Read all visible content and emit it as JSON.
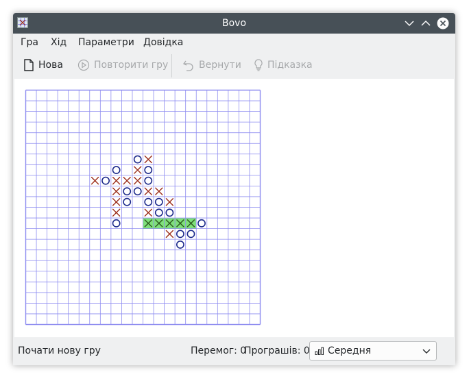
{
  "window": {
    "title": "Bovo"
  },
  "menu": [
    "Гра",
    "Хід",
    "Параметри",
    "Довідка"
  ],
  "toolbar": {
    "new": "Нова",
    "replay": "Повторити гру",
    "undo": "Вернути",
    "hint": "Підказка"
  },
  "board": {
    "columns": 22,
    "rows": 22,
    "grid_color": "#8e8cf0",
    "x_color": "#9c2d1a",
    "o_color": "#1c2a8c",
    "win_color": "#7ee07a",
    "moves": [
      {
        "c": 11,
        "r": 6,
        "m": "X"
      },
      {
        "c": 10,
        "r": 6,
        "m": "O"
      },
      {
        "c": 8,
        "r": 7,
        "m": "O"
      },
      {
        "c": 11,
        "r": 7,
        "m": "O"
      },
      {
        "c": 10,
        "r": 7,
        "m": "X"
      },
      {
        "c": 6,
        "r": 8,
        "m": "X"
      },
      {
        "c": 7,
        "r": 8,
        "m": "O"
      },
      {
        "c": 8,
        "r": 8,
        "m": "X"
      },
      {
        "c": 9,
        "r": 8,
        "m": "X"
      },
      {
        "c": 10,
        "r": 8,
        "m": "X"
      },
      {
        "c": 11,
        "r": 8,
        "m": "O"
      },
      {
        "c": 8,
        "r": 9,
        "m": "X"
      },
      {
        "c": 9,
        "r": 9,
        "m": "O"
      },
      {
        "c": 10,
        "r": 9,
        "m": "O"
      },
      {
        "c": 11,
        "r": 9,
        "m": "X"
      },
      {
        "c": 12,
        "r": 9,
        "m": "X"
      },
      {
        "c": 8,
        "r": 10,
        "m": "X"
      },
      {
        "c": 9,
        "r": 10,
        "m": "O"
      },
      {
        "c": 11,
        "r": 10,
        "m": "O"
      },
      {
        "c": 12,
        "r": 10,
        "m": "O"
      },
      {
        "c": 13,
        "r": 10,
        "m": "X"
      },
      {
        "c": 8,
        "r": 11,
        "m": "X"
      },
      {
        "c": 11,
        "r": 11,
        "m": "X"
      },
      {
        "c": 12,
        "r": 11,
        "m": "O"
      },
      {
        "c": 13,
        "r": 11,
        "m": "O"
      },
      {
        "c": 8,
        "r": 12,
        "m": "O"
      },
      {
        "c": 11,
        "r": 12,
        "m": "X",
        "win": true
      },
      {
        "c": 12,
        "r": 12,
        "m": "X",
        "win": true
      },
      {
        "c": 13,
        "r": 12,
        "m": "X",
        "win": true
      },
      {
        "c": 14,
        "r": 12,
        "m": "X",
        "win": true
      },
      {
        "c": 15,
        "r": 12,
        "m": "X",
        "win": true
      },
      {
        "c": 16,
        "r": 12,
        "m": "O"
      },
      {
        "c": 13,
        "r": 13,
        "m": "X"
      },
      {
        "c": 14,
        "r": 13,
        "m": "O"
      },
      {
        "c": 15,
        "r": 13,
        "m": "O"
      },
      {
        "c": 14,
        "r": 14,
        "m": "O"
      }
    ]
  },
  "status": {
    "message": "Почати нову гру",
    "wins": "Перемог: 0",
    "losses": "Програшів: 0",
    "difficulty": "Середня"
  }
}
